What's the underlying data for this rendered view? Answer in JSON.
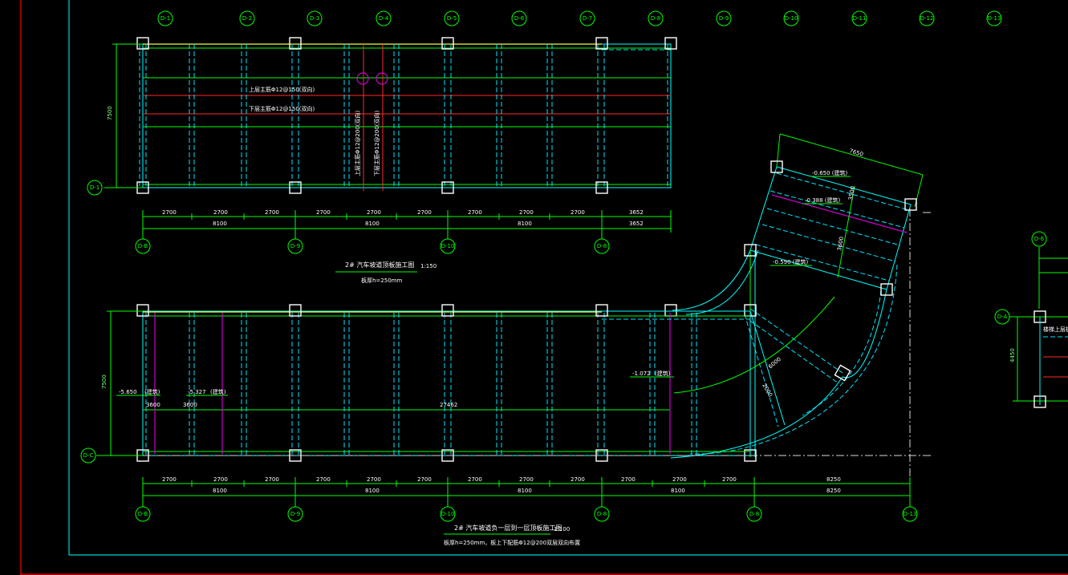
{
  "drawing": {
    "frame_color": "#ff0000",
    "inner_frame_color": "#00ffff",
    "background": "#000000",
    "top_axes": [
      "D-1",
      "D-2",
      "D-3",
      "D-4",
      "D-5",
      "D-6",
      "D-7",
      "D-8",
      "D-9",
      "D-10",
      "D-11",
      "D-12",
      "D-13"
    ]
  },
  "plan1": {
    "title": "2# 汽车坡道顶板施工图",
    "scale": "1:150",
    "note": "板厚h=250mm",
    "row_axis": "D-1",
    "height_dim": "7500",
    "col_axes": [
      "D-B",
      "D-9",
      "D-10",
      "D-8"
    ],
    "dims_row1": [
      "2700",
      "2700",
      "2700",
      "2700",
      "2700",
      "2700",
      "2700",
      "2700",
      "2700",
      "3652"
    ],
    "dims_row2": [
      "8100",
      "8100",
      "8100",
      "3652"
    ],
    "rebar_labels": [
      "上层主筋Φ12@150(双向)",
      "下层主筋Φ12@150(双向)",
      "上层主筋Φ12@200(双向)",
      "下层主筋Φ12@200(双向)"
    ]
  },
  "plan2": {
    "title": "2# 汽车坡道负一层到一层顶板施工图",
    "scale": "1:100",
    "note": "板厚h=250mm，板上下配筋Φ12@200双层双向布置",
    "row_axis": "D-C",
    "height_dim": "7500",
    "col_axes": [
      "D-B",
      "D-9",
      "D-10",
      "D-8",
      "D-8",
      "D-13"
    ],
    "dims_row1": [
      "2700",
      "2700",
      "2700",
      "2700",
      "2700",
      "2700",
      "2700",
      "2700",
      "2700",
      "2700",
      "2700",
      "2700",
      "8250"
    ],
    "dims_row2": [
      "8100",
      "8100",
      "8100",
      "8100",
      "8250"
    ],
    "levels": [
      "-5.650",
      "-5.327",
      "-1.072"
    ],
    "level_note": "(建筑)",
    "spans": [
      "3600",
      "3600",
      "27462"
    ]
  },
  "ramp": {
    "dim_top": "7650",
    "levels": [
      "-0.650 (建筑)",
      "-0.388 (建筑)",
      "-0.590 (建筑)"
    ],
    "dims": [
      "3500",
      "3600"
    ],
    "arc_labels": [
      "6000",
      "2000"
    ]
  },
  "partial_view": {
    "axes": [
      "D-6",
      "D-A"
    ],
    "height_dim": "4450",
    "label": "楼梯上层板"
  }
}
